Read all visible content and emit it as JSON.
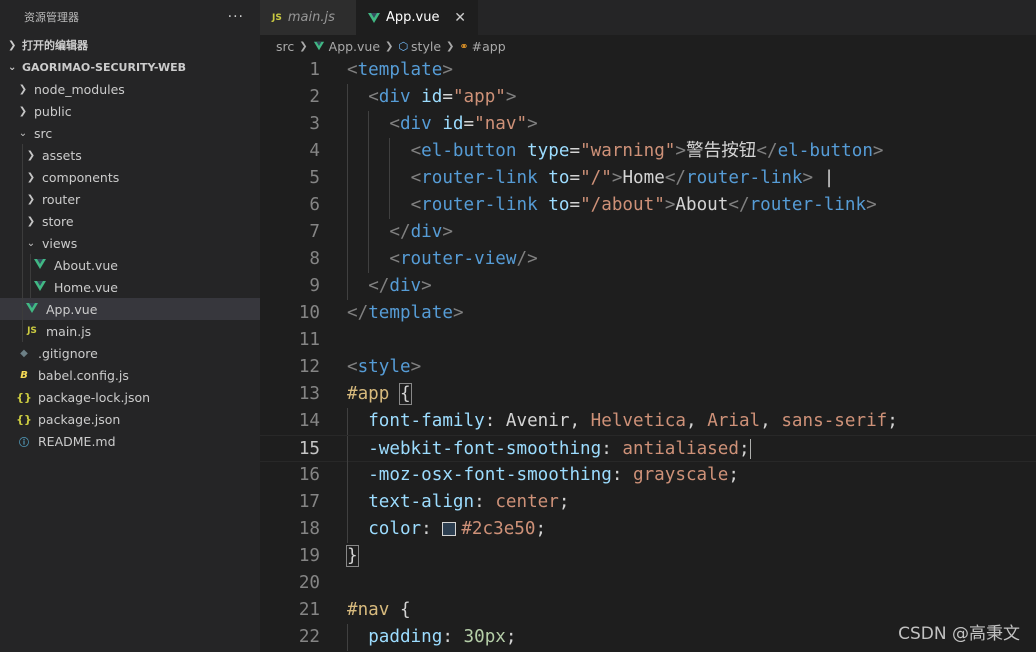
{
  "sidebar": {
    "title": "资源管理器",
    "more": "···",
    "open_editors": "打开的编辑器",
    "project": "GAORIMAO-SECURITY-WEB",
    "items": [
      {
        "label": "node_modules",
        "type": "folder",
        "open": false,
        "depth": 1
      },
      {
        "label": "public",
        "type": "folder",
        "open": false,
        "depth": 1
      },
      {
        "label": "src",
        "type": "folder",
        "open": true,
        "depth": 1
      },
      {
        "label": "assets",
        "type": "folder",
        "open": false,
        "depth": 2
      },
      {
        "label": "components",
        "type": "folder",
        "open": false,
        "depth": 2
      },
      {
        "label": "router",
        "type": "folder",
        "open": false,
        "depth": 2
      },
      {
        "label": "store",
        "type": "folder",
        "open": false,
        "depth": 2
      },
      {
        "label": "views",
        "type": "folder",
        "open": true,
        "depth": 2
      },
      {
        "label": "About.vue",
        "type": "vue",
        "depth": 3
      },
      {
        "label": "Home.vue",
        "type": "vue",
        "depth": 3
      },
      {
        "label": "App.vue",
        "type": "vue",
        "depth": 2,
        "selected": true
      },
      {
        "label": "main.js",
        "type": "js",
        "depth": 2
      },
      {
        "label": ".gitignore",
        "type": "git",
        "depth": 1
      },
      {
        "label": "babel.config.js",
        "type": "babel",
        "depth": 1
      },
      {
        "label": "package-lock.json",
        "type": "json",
        "depth": 1
      },
      {
        "label": "package.json",
        "type": "json",
        "depth": 1
      },
      {
        "label": "README.md",
        "type": "md",
        "depth": 1
      }
    ]
  },
  "tabs": [
    {
      "label": "main.js",
      "icon": "JS",
      "active": false
    },
    {
      "label": "App.vue",
      "icon": "vue",
      "active": true,
      "close": "✕"
    }
  ],
  "breadcrumb": {
    "src": "src",
    "file": "App.vue",
    "style": "style",
    "app": "#app"
  },
  "editor": {
    "current_line": 15,
    "lines": [
      {
        "n": "1",
        "tokens": [
          [
            "p",
            "<"
          ],
          [
            "tag",
            "template"
          ],
          [
            "p",
            ">"
          ]
        ]
      },
      {
        "n": "2",
        "tokens": [
          [
            "txt",
            "  "
          ],
          [
            "p",
            "<"
          ],
          [
            "tag",
            "div"
          ],
          [
            "txt",
            " "
          ],
          [
            "attr",
            "id"
          ],
          [
            "txt",
            "="
          ],
          [
            "str",
            "\"app\""
          ],
          [
            "p",
            ">"
          ]
        ]
      },
      {
        "n": "3",
        "tokens": [
          [
            "txt",
            "    "
          ],
          [
            "p",
            "<"
          ],
          [
            "tag",
            "div"
          ],
          [
            "txt",
            " "
          ],
          [
            "attr",
            "id"
          ],
          [
            "txt",
            "="
          ],
          [
            "str",
            "\"nav\""
          ],
          [
            "p",
            ">"
          ]
        ]
      },
      {
        "n": "4",
        "tokens": [
          [
            "txt",
            "      "
          ],
          [
            "p",
            "<"
          ],
          [
            "tag",
            "el-button"
          ],
          [
            "txt",
            " "
          ],
          [
            "attr",
            "type"
          ],
          [
            "txt",
            "="
          ],
          [
            "str",
            "\"warning\""
          ],
          [
            "p",
            ">"
          ],
          [
            "txt",
            "警告按钮"
          ],
          [
            "p",
            "</"
          ],
          [
            "tag",
            "el-button"
          ],
          [
            "p",
            ">"
          ]
        ]
      },
      {
        "n": "5",
        "tokens": [
          [
            "txt",
            "      "
          ],
          [
            "p",
            "<"
          ],
          [
            "tag",
            "router-link"
          ],
          [
            "txt",
            " "
          ],
          [
            "attr",
            "to"
          ],
          [
            "txt",
            "="
          ],
          [
            "str",
            "\"/\""
          ],
          [
            "p",
            ">"
          ],
          [
            "txt",
            "Home"
          ],
          [
            "p",
            "</"
          ],
          [
            "tag",
            "router-link"
          ],
          [
            "p",
            ">"
          ],
          [
            "txt",
            " |"
          ]
        ]
      },
      {
        "n": "6",
        "tokens": [
          [
            "txt",
            "      "
          ],
          [
            "p",
            "<"
          ],
          [
            "tag",
            "router-link"
          ],
          [
            "txt",
            " "
          ],
          [
            "attr",
            "to"
          ],
          [
            "txt",
            "="
          ],
          [
            "str",
            "\"/about\""
          ],
          [
            "p",
            ">"
          ],
          [
            "txt",
            "About"
          ],
          [
            "p",
            "</"
          ],
          [
            "tag",
            "router-link"
          ],
          [
            "p",
            ">"
          ]
        ]
      },
      {
        "n": "7",
        "tokens": [
          [
            "txt",
            "    "
          ],
          [
            "p",
            "</"
          ],
          [
            "tag",
            "div"
          ],
          [
            "p",
            ">"
          ]
        ]
      },
      {
        "n": "8",
        "tokens": [
          [
            "txt",
            "    "
          ],
          [
            "p",
            "<"
          ],
          [
            "tag",
            "router-view"
          ],
          [
            "p",
            "/>"
          ]
        ]
      },
      {
        "n": "9",
        "tokens": [
          [
            "txt",
            "  "
          ],
          [
            "p",
            "</"
          ],
          [
            "tag",
            "div"
          ],
          [
            "p",
            ">"
          ]
        ]
      },
      {
        "n": "10",
        "tokens": [
          [
            "p",
            "</"
          ],
          [
            "tag",
            "template"
          ],
          [
            "p",
            ">"
          ]
        ]
      },
      {
        "n": "11",
        "tokens": []
      },
      {
        "n": "12",
        "tokens": [
          [
            "p",
            "<"
          ],
          [
            "tag",
            "style"
          ],
          [
            "p",
            ">"
          ]
        ]
      },
      {
        "n": "13",
        "tokens": [
          [
            "sel",
            "#app"
          ],
          [
            "txt",
            " "
          ],
          [
            "brk",
            "{"
          ]
        ]
      },
      {
        "n": "14",
        "tokens": [
          [
            "txt",
            "  "
          ],
          [
            "prop",
            "font-family"
          ],
          [
            "txt",
            ": Avenir, "
          ],
          [
            "val",
            "Helvetica"
          ],
          [
            "txt",
            ", "
          ],
          [
            "val",
            "Arial"
          ],
          [
            "txt",
            ", "
          ],
          [
            "val",
            "sans-serif"
          ],
          [
            "txt",
            ";"
          ]
        ]
      },
      {
        "n": "15",
        "tokens": [
          [
            "txt",
            "  "
          ],
          [
            "prop",
            "-webkit-font-smoothing"
          ],
          [
            "txt",
            ": "
          ],
          [
            "val",
            "antialiased"
          ],
          [
            "txt",
            ";"
          ],
          [
            "cursor",
            ""
          ]
        ]
      },
      {
        "n": "16",
        "tokens": [
          [
            "txt",
            "  "
          ],
          [
            "prop",
            "-moz-osx-font-smoothing"
          ],
          [
            "txt",
            ": "
          ],
          [
            "val",
            "grayscale"
          ],
          [
            "txt",
            ";"
          ]
        ]
      },
      {
        "n": "17",
        "tokens": [
          [
            "txt",
            "  "
          ],
          [
            "prop",
            "text-align"
          ],
          [
            "txt",
            ": "
          ],
          [
            "val",
            "center"
          ],
          [
            "txt",
            ";"
          ]
        ]
      },
      {
        "n": "18",
        "tokens": [
          [
            "txt",
            "  "
          ],
          [
            "prop",
            "color"
          ],
          [
            "txt",
            ": "
          ],
          [
            "swatch",
            "#2c3e50"
          ],
          [
            "val",
            "#2c3e50"
          ],
          [
            "txt",
            ";"
          ]
        ]
      },
      {
        "n": "19",
        "tokens": [
          [
            "brk",
            "}"
          ]
        ]
      },
      {
        "n": "20",
        "tokens": []
      },
      {
        "n": "21",
        "tokens": [
          [
            "sel",
            "#nav"
          ],
          [
            "txt",
            " {"
          ]
        ]
      },
      {
        "n": "22",
        "tokens": [
          [
            "txt",
            "  "
          ],
          [
            "prop",
            "padding"
          ],
          [
            "txt",
            ": "
          ],
          [
            "num",
            "30px"
          ],
          [
            "txt",
            ";"
          ]
        ]
      }
    ]
  },
  "watermark": "CSDN @高秉文"
}
